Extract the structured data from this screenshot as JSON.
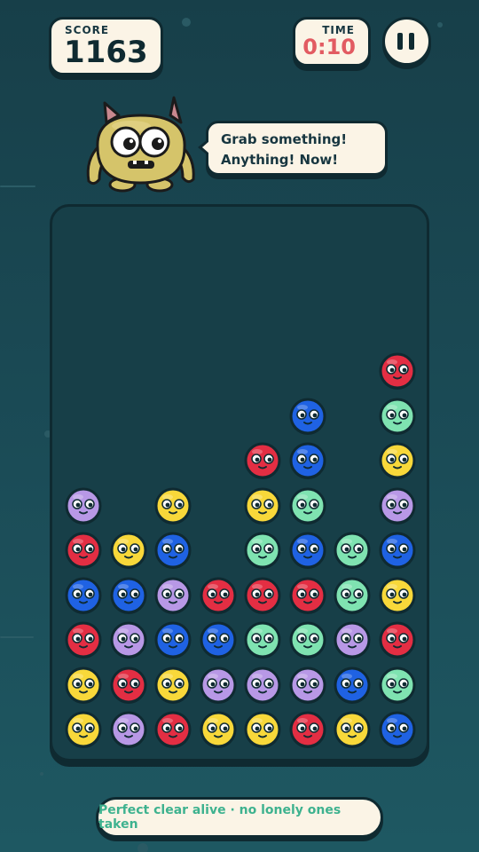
{
  "hud": {
    "score_label": "SCORE",
    "score_value": "1163",
    "time_label": "TIME",
    "time_value": "0:10",
    "pause_icon": "pause-icon"
  },
  "mascot": {
    "icon": "monster-icon",
    "speech_line_1": "Grab something!",
    "speech_line_2": "Anything! Now!"
  },
  "board": {
    "columns": 8,
    "rows": 9,
    "colors": {
      "red": "#e32e43",
      "yellow": "#f8d83a",
      "blue": "#1f62e3",
      "purple": "#b898e6",
      "green": "#7fe3b1"
    },
    "grid": [
      [
        null,
        null,
        null,
        null,
        null,
        null,
        null,
        "red"
      ],
      [
        null,
        null,
        null,
        null,
        null,
        "blue",
        null,
        "green"
      ],
      [
        null,
        null,
        null,
        null,
        "red",
        "blue",
        null,
        "yellow"
      ],
      [
        "purple",
        null,
        "yellow",
        null,
        "yellow",
        "green",
        null,
        "purple"
      ],
      [
        "red",
        "yellow",
        "blue",
        null,
        "green",
        "blue",
        "green",
        "blue"
      ],
      [
        "blue",
        "blue",
        "purple",
        "red",
        "red",
        "red",
        "green",
        "yellow"
      ],
      [
        "red",
        "purple",
        "blue",
        "blue",
        "green",
        "green",
        "purple",
        "red"
      ],
      [
        "yellow",
        "red",
        "yellow",
        "purple",
        "purple",
        "purple",
        "blue",
        "green"
      ],
      [
        "yellow",
        "purple",
        "red",
        "yellow",
        "yellow",
        "red",
        "yellow",
        "blue"
      ]
    ]
  },
  "status": {
    "text": "Perfect clear alive · no lonely ones taken"
  }
}
